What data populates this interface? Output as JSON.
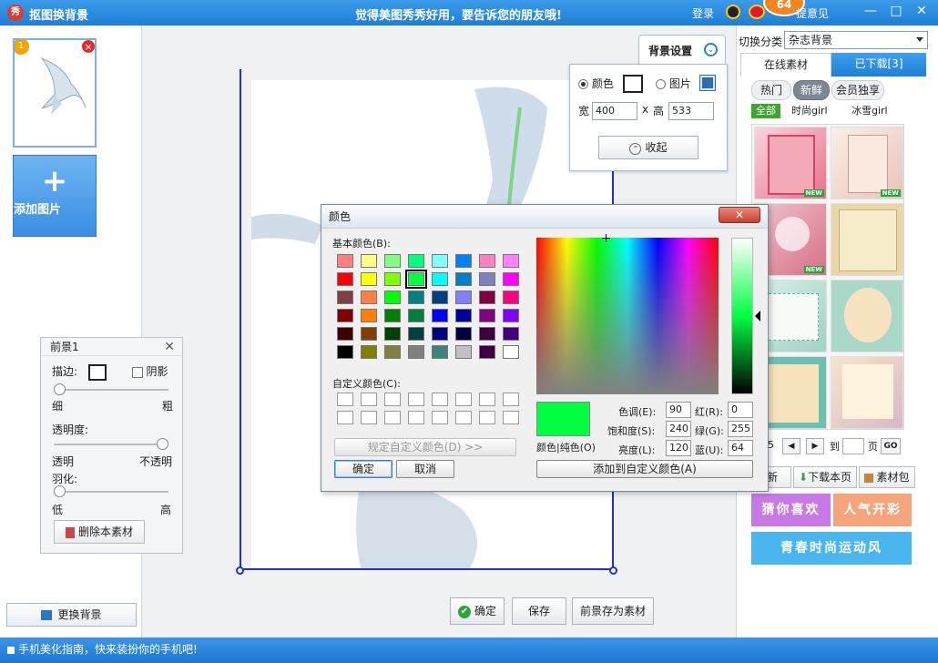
{
  "titlebar": {
    "logo_text": "秀",
    "title": "抠图换背景",
    "slogan": "觉得美图秀秀好用，要告诉您的朋友哦!",
    "login": "登录",
    "badge_count": "64",
    "feedback": "提意见",
    "minimize": "—",
    "maximize": "□",
    "close": "✕"
  },
  "left": {
    "thumb_number": "1",
    "thumb_delete": "×",
    "add_plus": "+",
    "add_label": "添加图片",
    "change_bg": "更换背景"
  },
  "fgpanel": {
    "title": "前景1",
    "close": "✕",
    "stroke_label": "描边:",
    "shadow_label": "阴影",
    "thin": "细",
    "thick": "粗",
    "opacity_label": "透明度:",
    "transparent": "透明",
    "opaque": "不透明",
    "feather_label": "羽化:",
    "low": "低",
    "high": "高",
    "delete_btn": "删除本素材",
    "stroke_value": 0,
    "opacity_value": 1,
    "feather_value": 0
  },
  "bgsettings": {
    "tab_label": "背景设置",
    "chevron": "⌄",
    "color_label": "颜色",
    "image_label": "图片",
    "width_label": "宽",
    "width_value": "400",
    "times": "x",
    "height_label": "高",
    "height_value": "533",
    "collapse_label": "收起",
    "collapse_icon": "⌃",
    "selected_mode": "color"
  },
  "bottom": {
    "ok": "确定",
    "ok_icon": "✔",
    "save": "保存",
    "save_as_material": "前景存为素材"
  },
  "right": {
    "category_label": "切换分类",
    "category_value": "杂志背景",
    "tab_online": "在线素材",
    "tab_downloaded": "已下载[3]",
    "sub_hot": "热门",
    "sub_new": "新鲜",
    "sub_vip": "会员独享",
    "tag_all": "全部",
    "tag_fashion": "时尚girl",
    "tag_ice": "冰雪girl",
    "new_badge": "NEW",
    "page_prefix": "5",
    "page_prev": "◀",
    "page_next": "▶",
    "page_to": "到",
    "page_unit": "页",
    "page_go": "GO",
    "refresh": "刷新",
    "download_page": "下载本页",
    "material_pack": "素材包",
    "promo1": "猜你喜欢",
    "promo2": "人气开彩",
    "promo3": "青春时尚运动风",
    "colors": {
      "promo1": "#c879e8",
      "promo2": "#f6a47c",
      "promo3": "#49b6ef"
    }
  },
  "colordialog": {
    "title": "颜色",
    "close": "✕",
    "basic_colors_label": "基本颜色(B):",
    "custom_colors_label": "自定义颜色(C):",
    "define_custom_btn": "规定自定义颜色(D) >>",
    "ok": "确定",
    "cancel": "取消",
    "hue_label": "色调(E):",
    "hue": "90",
    "sat_label": "饱和度(S):",
    "sat": "240",
    "lum_label": "亮度(L):",
    "lum": "120",
    "red_label": "红(R):",
    "red": "0",
    "green_label": "绿(G):",
    "green": "255",
    "blue_label": "蓝(U):",
    "blue": "64",
    "color_solid_label": "颜色|纯色(O)",
    "add_custom_btn": "添加到自定义颜色(A)",
    "basic_colors": [
      [
        "#ff8080",
        "#ffff80",
        "#80ff80",
        "#00ff80",
        "#80ffff",
        "#0080ff",
        "#ff80c0",
        "#ff80ff"
      ],
      [
        "#ff0000",
        "#ffff00",
        "#80ff00",
        "#00ff40",
        "#00ffff",
        "#0080c0",
        "#8080c0",
        "#ff00ff"
      ],
      [
        "#804040",
        "#ff8040",
        "#00ff00",
        "#008080",
        "#004080",
        "#8080ff",
        "#800040",
        "#ff0080"
      ],
      [
        "#800000",
        "#ff8000",
        "#008000",
        "#008040",
        "#0000ff",
        "#0000a0",
        "#800080",
        "#8000ff"
      ],
      [
        "#400000",
        "#804000",
        "#004000",
        "#004040",
        "#000080",
        "#000040",
        "#400040",
        "#400080"
      ],
      [
        "#000000",
        "#808000",
        "#808040",
        "#808080",
        "#408080",
        "#c0c0c0",
        "#400040",
        "#ffffff"
      ]
    ],
    "selected_color": "#00ff40"
  },
  "statusbar": {
    "text": "手机美化指南，快来装扮你的手机吧!"
  }
}
